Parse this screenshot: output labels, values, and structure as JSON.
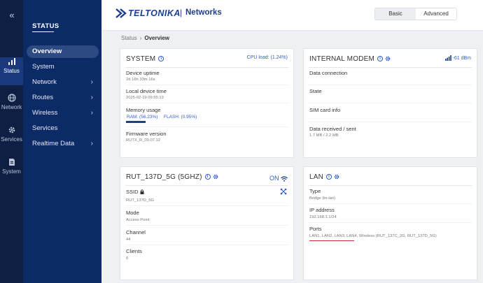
{
  "brand": {
    "name": "TELTONIKA",
    "separator": "|",
    "product": "Networks"
  },
  "mode_toggle": {
    "basic": "Basic",
    "advanced": "Advanced",
    "selected": "Advanced"
  },
  "rail": {
    "toggle": "«",
    "items": [
      {
        "label": "Status",
        "icon": "signal-bars-icon",
        "active": true
      },
      {
        "label": "Network",
        "icon": "globe-icon",
        "active": false
      },
      {
        "label": "Services",
        "icon": "gear-icon",
        "active": false
      },
      {
        "label": "System",
        "icon": "document-icon",
        "active": false
      }
    ]
  },
  "menu": {
    "title": "STATUS",
    "items": [
      {
        "label": "Overview",
        "active": true,
        "has_submenu": false
      },
      {
        "label": "System",
        "active": false,
        "has_submenu": false
      },
      {
        "label": "Network",
        "active": false,
        "has_submenu": true
      },
      {
        "label": "Routes",
        "active": false,
        "has_submenu": true
      },
      {
        "label": "Wireless",
        "active": false,
        "has_submenu": true
      },
      {
        "label": "Services",
        "active": false,
        "has_submenu": false
      },
      {
        "label": "Realtime Data",
        "active": false,
        "has_submenu": true
      }
    ]
  },
  "breadcrumb": {
    "parent": "Status",
    "current": "Overview"
  },
  "system_card": {
    "title": "SYSTEM",
    "cpu_load": "CPU load: (1.24%)",
    "uptime_label": "Device uptime",
    "uptime_value": "2d 16h 33m 16s",
    "time_label": "Local device time",
    "time_value": "2025-02-19 09:55:13",
    "memory_label": "Memory usage",
    "ram": "RAM: (56.23%)",
    "flash": "FLASH: (0.95%)",
    "firmware_label": "Firmware version",
    "firmware_value": "RUTX_R_00.07.12"
  },
  "modem_card": {
    "title": "INTERNAL MODEM",
    "signal": "-61 dBm",
    "data_connection_label": "Data connection",
    "state_label": "State",
    "sim_label": "SIM card info",
    "data_label": "Data received / sent",
    "data_value": "1.7 MB / 2.2 MB"
  },
  "wifi_card": {
    "title": "RUT_137D_5G (5GHZ)",
    "status": "ON",
    "ssid_label": "SSID",
    "ssid_value": "RUT_137D_5G",
    "mode_label": "Mode",
    "mode_value": "Access Point",
    "channel_label": "Channel",
    "channel_value": "44",
    "clients_label": "Clients",
    "clients_value": "0"
  },
  "lan_card": {
    "title": "LAN",
    "type_label": "Type",
    "type_value": "Bridge (br-lan)",
    "ip_label": "IP address",
    "ip_value": "192.168.1.1/24",
    "ports_label": "Ports",
    "ports_value": "LAN1, LAN2, LAN3, LAN4, Wireless (RUT_137C_2G, RUT_137D_5G)"
  },
  "colors": {
    "sidebar": "#0c2b66",
    "rail": "#0f1f44",
    "accent": "#2e5dc6",
    "brand": "#1b3e8f",
    "annotation": "#d03030"
  }
}
